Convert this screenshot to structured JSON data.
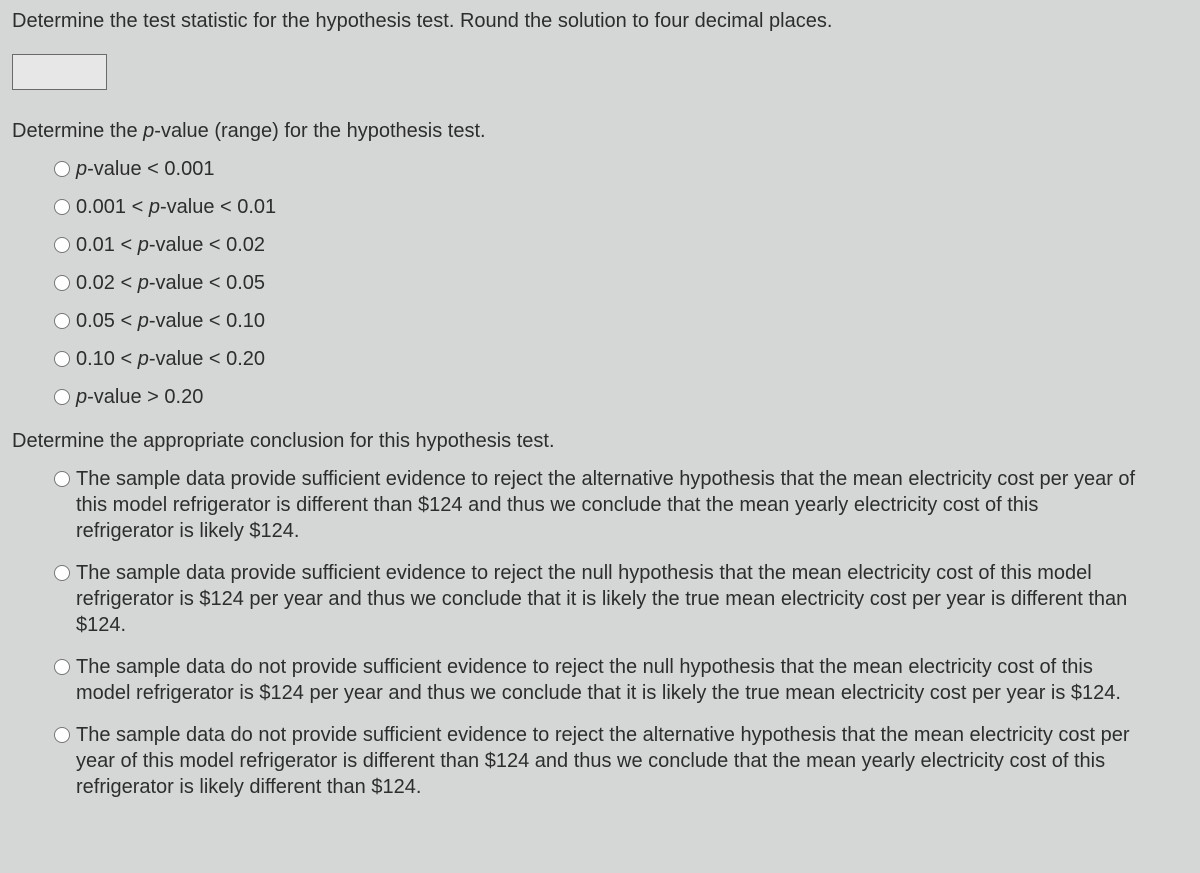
{
  "q1": {
    "prompt": "Determine the test statistic for the hypothesis test. Round the solution to four decimal places.",
    "value": ""
  },
  "q2": {
    "prompt_pre": "Determine the ",
    "prompt_italic": "p",
    "prompt_post": "-value (range) for the hypothesis test.",
    "options": [
      {
        "pre": "",
        "ital": "p",
        "post": "-value < 0.001"
      },
      {
        "pre": "0.001 < ",
        "ital": "p",
        "post": "-value < 0.01"
      },
      {
        "pre": "0.01 < ",
        "ital": "p",
        "post": "-value < 0.02"
      },
      {
        "pre": "0.02 < ",
        "ital": "p",
        "post": "-value < 0.05"
      },
      {
        "pre": "0.05 < ",
        "ital": "p",
        "post": "-value < 0.10"
      },
      {
        "pre": "0.10 < ",
        "ital": "p",
        "post": "-value < 0.20"
      },
      {
        "pre": "",
        "ital": "p",
        "post": "-value > 0.20"
      }
    ]
  },
  "q3": {
    "prompt": "Determine the appropriate conclusion for this hypothesis test.",
    "options": [
      "The sample data provide sufficient evidence to reject the alternative hypothesis that the mean electricity cost per year of this model refrigerator is different than $124 and thus we conclude that the mean yearly electricity cost of this refrigerator is likely $124.",
      "The sample data provide sufficient evidence to reject the null hypothesis that the mean electricity cost of this model refrigerator is $124 per year and thus we conclude that it is likely the true mean electricity cost per year is different than $124.",
      "The sample data do not provide sufficient evidence to reject the null hypothesis that the mean electricity cost of this model refrigerator is $124 per year and thus we conclude that it is likely the true mean electricity cost per year is $124.",
      "The sample data do not provide sufficient evidence to reject the alternative hypothesis that the mean electricity cost per year of this model refrigerator is different than $124 and thus we conclude that the mean yearly electricity cost of this refrigerator is likely different than $124."
    ]
  }
}
